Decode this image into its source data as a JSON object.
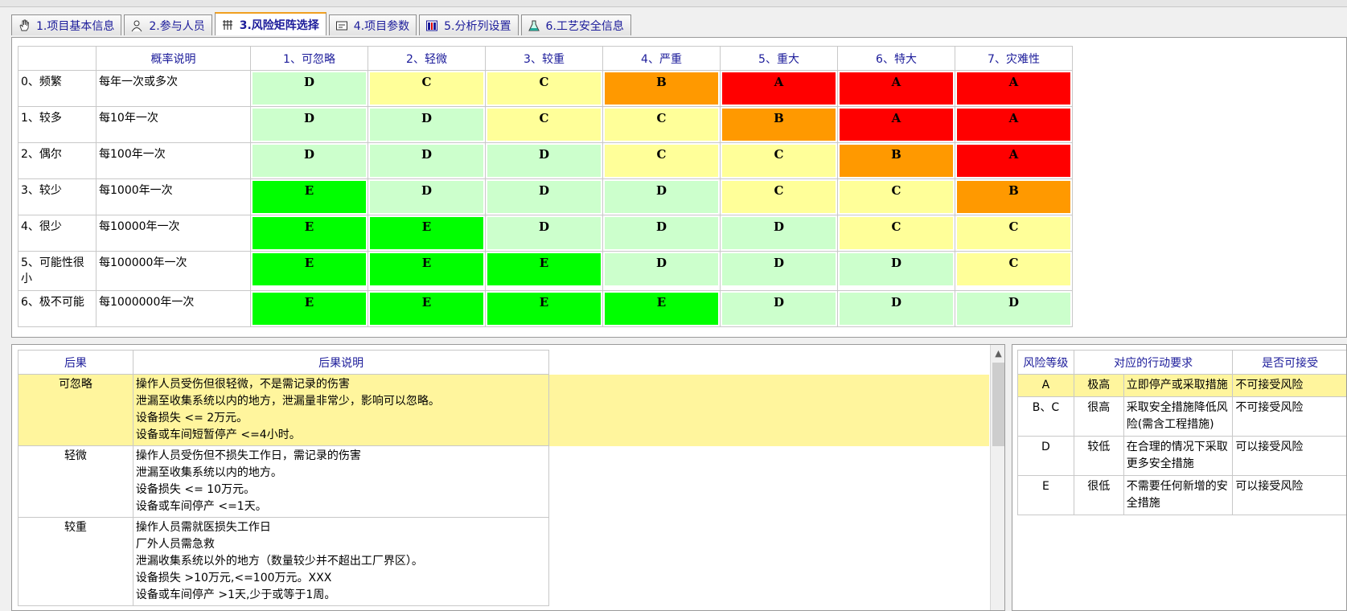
{
  "tabs": [
    {
      "label": "1.项目基本信息",
      "icon": "hand-icon",
      "active": false
    },
    {
      "label": "2.参与人员",
      "icon": "people-icon",
      "active": false
    },
    {
      "label": "3.风险矩阵选择",
      "icon": "grid-icon",
      "active": true
    },
    {
      "label": "4.项目参数",
      "icon": "form-icon",
      "active": false
    },
    {
      "label": "5.分析列设置",
      "icon": "columns-icon",
      "active": false
    },
    {
      "label": "6.工艺安全信息",
      "icon": "flask-icon",
      "active": false
    }
  ],
  "matrix": {
    "header_blank": "",
    "prob_header": "概率说明",
    "severity": [
      "1、可忽略",
      "2、轻微",
      "3、较重",
      "4、严重",
      "5、重大",
      "6、特大",
      "7、灾难性"
    ],
    "rows": [
      {
        "label": "0、频繁",
        "desc": "每年一次或多次",
        "cells": [
          "D",
          "C",
          "C",
          "B",
          "A",
          "A",
          "A"
        ]
      },
      {
        "label": "1、较多",
        "desc": "每10年一次",
        "cells": [
          "D",
          "D",
          "C",
          "C",
          "B",
          "A",
          "A"
        ]
      },
      {
        "label": "2、偶尔",
        "desc": "每100年一次",
        "cells": [
          "D",
          "D",
          "D",
          "C",
          "C",
          "B",
          "A"
        ]
      },
      {
        "label": "3、较少",
        "desc": "每1000年一次",
        "cells": [
          "E",
          "D",
          "D",
          "D",
          "C",
          "C",
          "B"
        ]
      },
      {
        "label": "4、很少",
        "desc": "每10000年一次",
        "cells": [
          "E",
          "E",
          "D",
          "D",
          "D",
          "C",
          "C"
        ]
      },
      {
        "label": "5、可能性很小",
        "desc": "每100000年一次",
        "cells": [
          "E",
          "E",
          "E",
          "D",
          "D",
          "D",
          "C"
        ]
      },
      {
        "label": "6、极不可能",
        "desc": "每1000000年一次",
        "cells": [
          "E",
          "E",
          "E",
          "E",
          "D",
          "D",
          "D"
        ]
      }
    ],
    "colors": {
      "A": "#ff0000",
      "B": "#ff9900",
      "C": "#ffff99",
      "D": "#ccffcc",
      "E": "#00ff00"
    }
  },
  "consequences": {
    "headers": [
      "后果",
      "后果说明"
    ],
    "rows": [
      {
        "name": "可忽略",
        "selected": true,
        "lines": [
          "操作人员受伤但很轻微，不是需记录的伤害",
          "泄漏至收集系统以内的地方，泄漏量非常少，影响可以忽略。",
          "设备损失 <= 2万元。",
          "设备或车间短暂停产 <=4小时。"
        ]
      },
      {
        "name": "轻微",
        "selected": false,
        "lines": [
          "操作人员受伤但不损失工作日，需记录的伤害",
          "泄漏至收集系统以内的地方。",
          "设备损失 <= 10万元。",
          "设备或车间停产 <=1天。"
        ]
      },
      {
        "name": "较重",
        "selected": false,
        "lines": [
          "操作人员需就医损失工作日",
          "厂外人员需急救",
          "泄漏收集系统以外的地方（数量较少并不超出工厂界区）。",
          "设备损失 >10万元,<=100万元。XXX",
          "设备或车间停产 >1天,少于或等于1周。"
        ]
      }
    ]
  },
  "risk_levels": {
    "headers": [
      "风险等级",
      "对应的行动要求",
      "是否可接受"
    ],
    "rows": [
      {
        "level": "A",
        "degree": "极高",
        "action": "立即停产或采取措施",
        "accept": "不可接受风险",
        "selected": true
      },
      {
        "level": "B、C",
        "degree": "很高",
        "action": "采取安全措施降低风险(需含工程措施)",
        "accept": "不可接受风险",
        "selected": false
      },
      {
        "level": "D",
        "degree": "较低",
        "action": "在合理的情况下采取更多安全措施",
        "accept": "可以接受风险",
        "selected": false
      },
      {
        "level": "E",
        "degree": "很低",
        "action": "不需要任何新增的安全措施",
        "accept": "可以接受风险",
        "selected": false
      }
    ]
  }
}
